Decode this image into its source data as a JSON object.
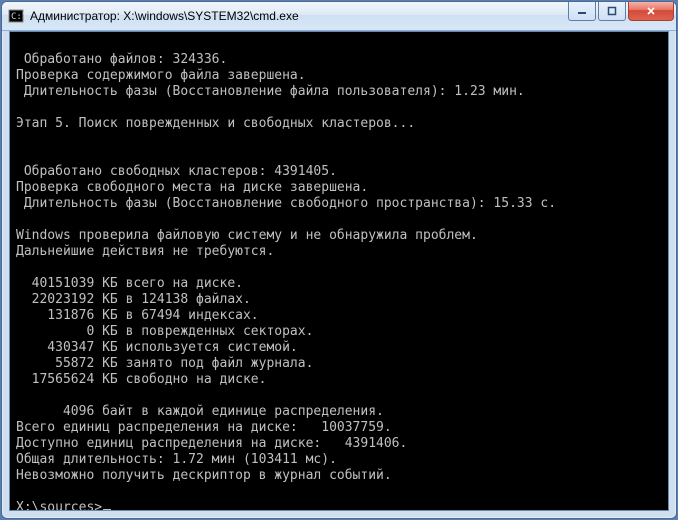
{
  "titlebar": {
    "title": "Администратор: X:\\windows\\SYSTEM32\\cmd.exe"
  },
  "terminal": {
    "lines": [
      "",
      " Обработано файлов: 324336.",
      "Проверка содержимого файла завершена.",
      " Длительность фазы (Восстановление файла пользователя): 1.23 мин.",
      "",
      "Этап 5. Поиск поврежденных и свободных кластеров...",
      "",
      "",
      " Обработано свободных кластеров: 4391405.",
      "Проверка свободного места на диске завершена.",
      " Длительность фазы (Восстановление свободного пространства): 15.33 с.",
      "",
      "Windows проверила файловую систему и не обнаружила проблем.",
      "Дальнейшие действия не требуются.",
      "",
      "  40151039 КБ всего на диске.",
      "  22023192 КБ в 124138 файлах.",
      "    131876 КБ в 67494 индексах.",
      "         0 КБ в поврежденных секторах.",
      "    430347 КБ используется системой.",
      "     55872 КБ занято под файл журнала.",
      "  17565624 КБ свободно на диске.",
      "",
      "      4096 байт в каждой единице распределения.",
      "Всего единиц распределения на диске:   10037759.",
      "Доступно единиц распределения на диске:   4391406.",
      "Общая длительность: 1.72 мин (103411 мс).",
      "Невозможно получить дескриптор в журнал событий.",
      ""
    ],
    "prompt": "X:\\sources>"
  }
}
